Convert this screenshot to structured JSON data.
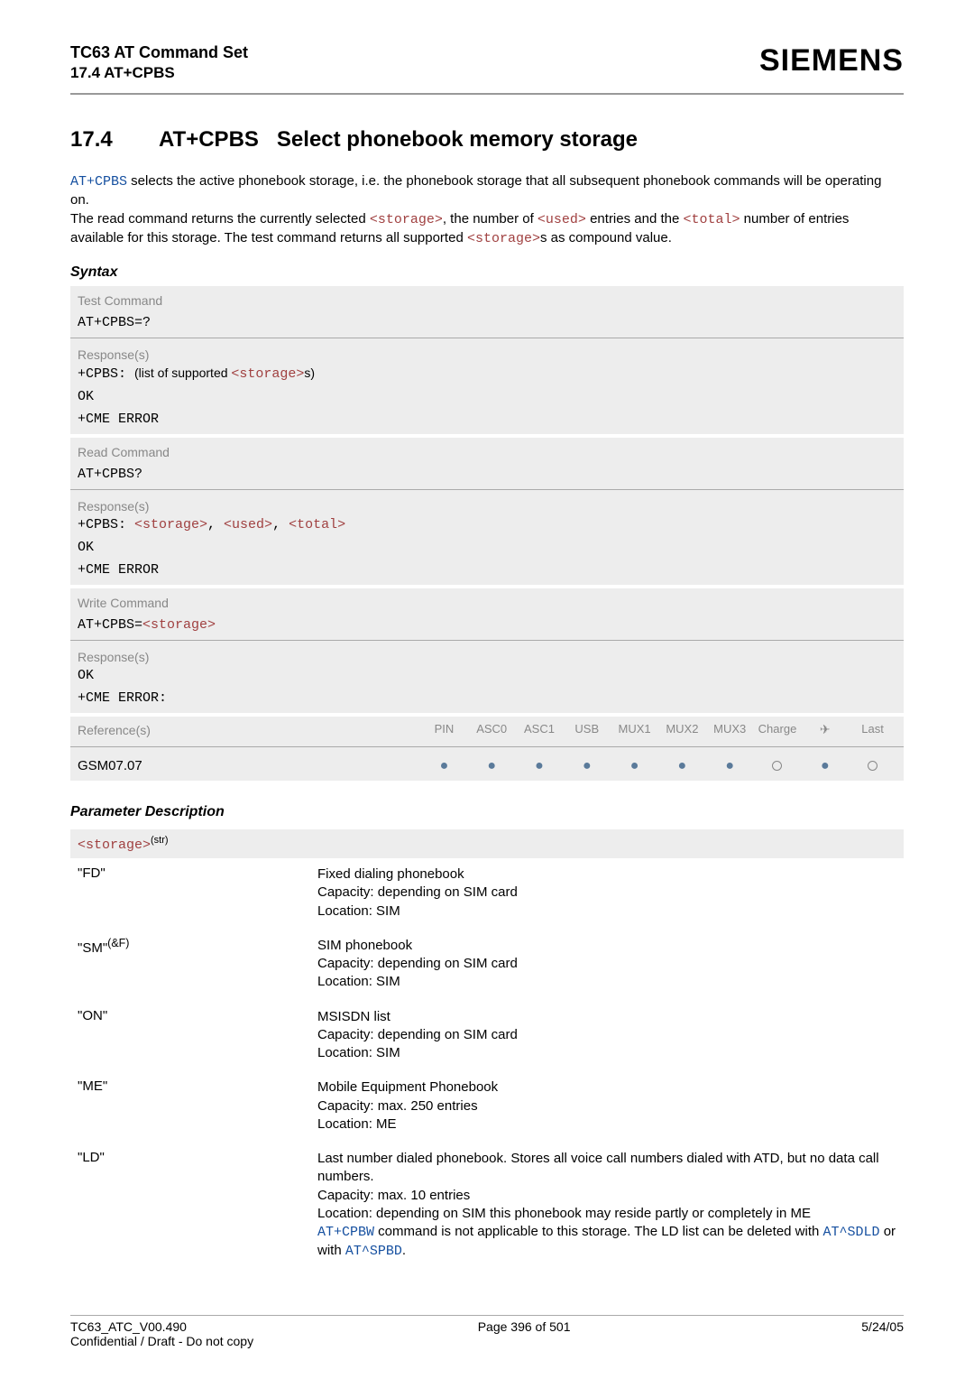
{
  "header": {
    "doc_title": "TC63 AT Command Set",
    "sub_title": "17.4 AT+CPBS",
    "logo": "SIEMENS"
  },
  "section": {
    "number": "17.4",
    "title_cmd": "AT+CPBS",
    "title_rest": "Select phonebook memory storage"
  },
  "intro": {
    "p1a": " selects the active phonebook storage, i.e. the phonebook storage that all subsequent phonebook commands will be operating on.",
    "p2a": "The read command returns the currently selected ",
    "p2b": ", the number of ",
    "p2c": " entries and the ",
    "p2d": " number of entries available for this storage. The test command returns all supported ",
    "p2e": "s as compound value.",
    "cmd": "AT+CPBS",
    "storage": "<storage>",
    "used": "<used>",
    "total": "<total>"
  },
  "syntax": {
    "label": "Syntax",
    "test_hdr": "Test Command",
    "test_cmd": "AT+CPBS=?",
    "resp_label": "Response(s)",
    "test_resp_mono": "+CPBS: ",
    "test_resp_txt": "(list of supported ",
    "test_resp_mono2": "<storage>",
    "test_resp_txt2": "s)",
    "ok": "OK",
    "cme": "+CME ERROR",
    "read_hdr": "Read Command",
    "read_cmd": "AT+CPBS?",
    "read_resp": "+CPBS: <storage>, <used>, <total>",
    "read_resp_pre": "+CPBS: ",
    "read_resp_s": "<storage>",
    "read_resp_u": "<used>",
    "read_resp_t": "<total>",
    "write_hdr": "Write Command",
    "write_cmd_pre": "AT+CPBS=",
    "write_cmd_arg": "<storage>",
    "cme_colon": "+CME ERROR:",
    "ref_label": "Reference(s)",
    "ref_headers": [
      "PIN",
      "ASC0",
      "ASC1",
      "USB",
      "MUX1",
      "MUX2",
      "MUX3",
      "Charge",
      "✈",
      "Last"
    ],
    "gsm": "GSM07.07"
  },
  "params": {
    "heading": "Parameter Description",
    "storage_tag": "<storage>",
    "storage_sup": "(str)",
    "rows": [
      {
        "key": "\"FD\"",
        "lines": [
          "Fixed dialing phonebook",
          "Capacity: depending on SIM card",
          "Location: SIM"
        ]
      },
      {
        "key_pre": "\"SM\"",
        "key_sup": "(&F)",
        "lines": [
          "SIM phonebook",
          "Capacity: depending on SIM card",
          "Location: SIM"
        ]
      },
      {
        "key": "\"ON\"",
        "lines": [
          "MSISDN list",
          "Capacity: depending on SIM card",
          "Location: SIM"
        ]
      },
      {
        "key": "\"ME\"",
        "lines": [
          "Mobile Equipment Phonebook",
          "Capacity: max. 250 entries",
          "Location: ME"
        ]
      },
      {
        "key": "\"LD\"",
        "ld_l1": "Last number dialed phonebook. Stores all voice call numbers dialed with ATD, but no data call numbers.",
        "ld_l2": "Capacity: max. 10 entries",
        "ld_l3": "Location: depending on SIM this phonebook may reside partly or completely in ME",
        "ld_l4a": " command is not applicable to this storage. The LD list can be deleted with ",
        "ld_l4b": " or with ",
        "ld_l4c": ".",
        "cpbw": "AT+CPBW",
        "sdld": "AT^SDLD",
        "spbd": "AT^SPBD"
      }
    ]
  },
  "footer": {
    "left1": "TC63_ATC_V00.490",
    "left2": "Confidential / Draft - Do not copy",
    "center": "Page 396 of 501",
    "right": "5/24/05"
  },
  "sep": ", "
}
